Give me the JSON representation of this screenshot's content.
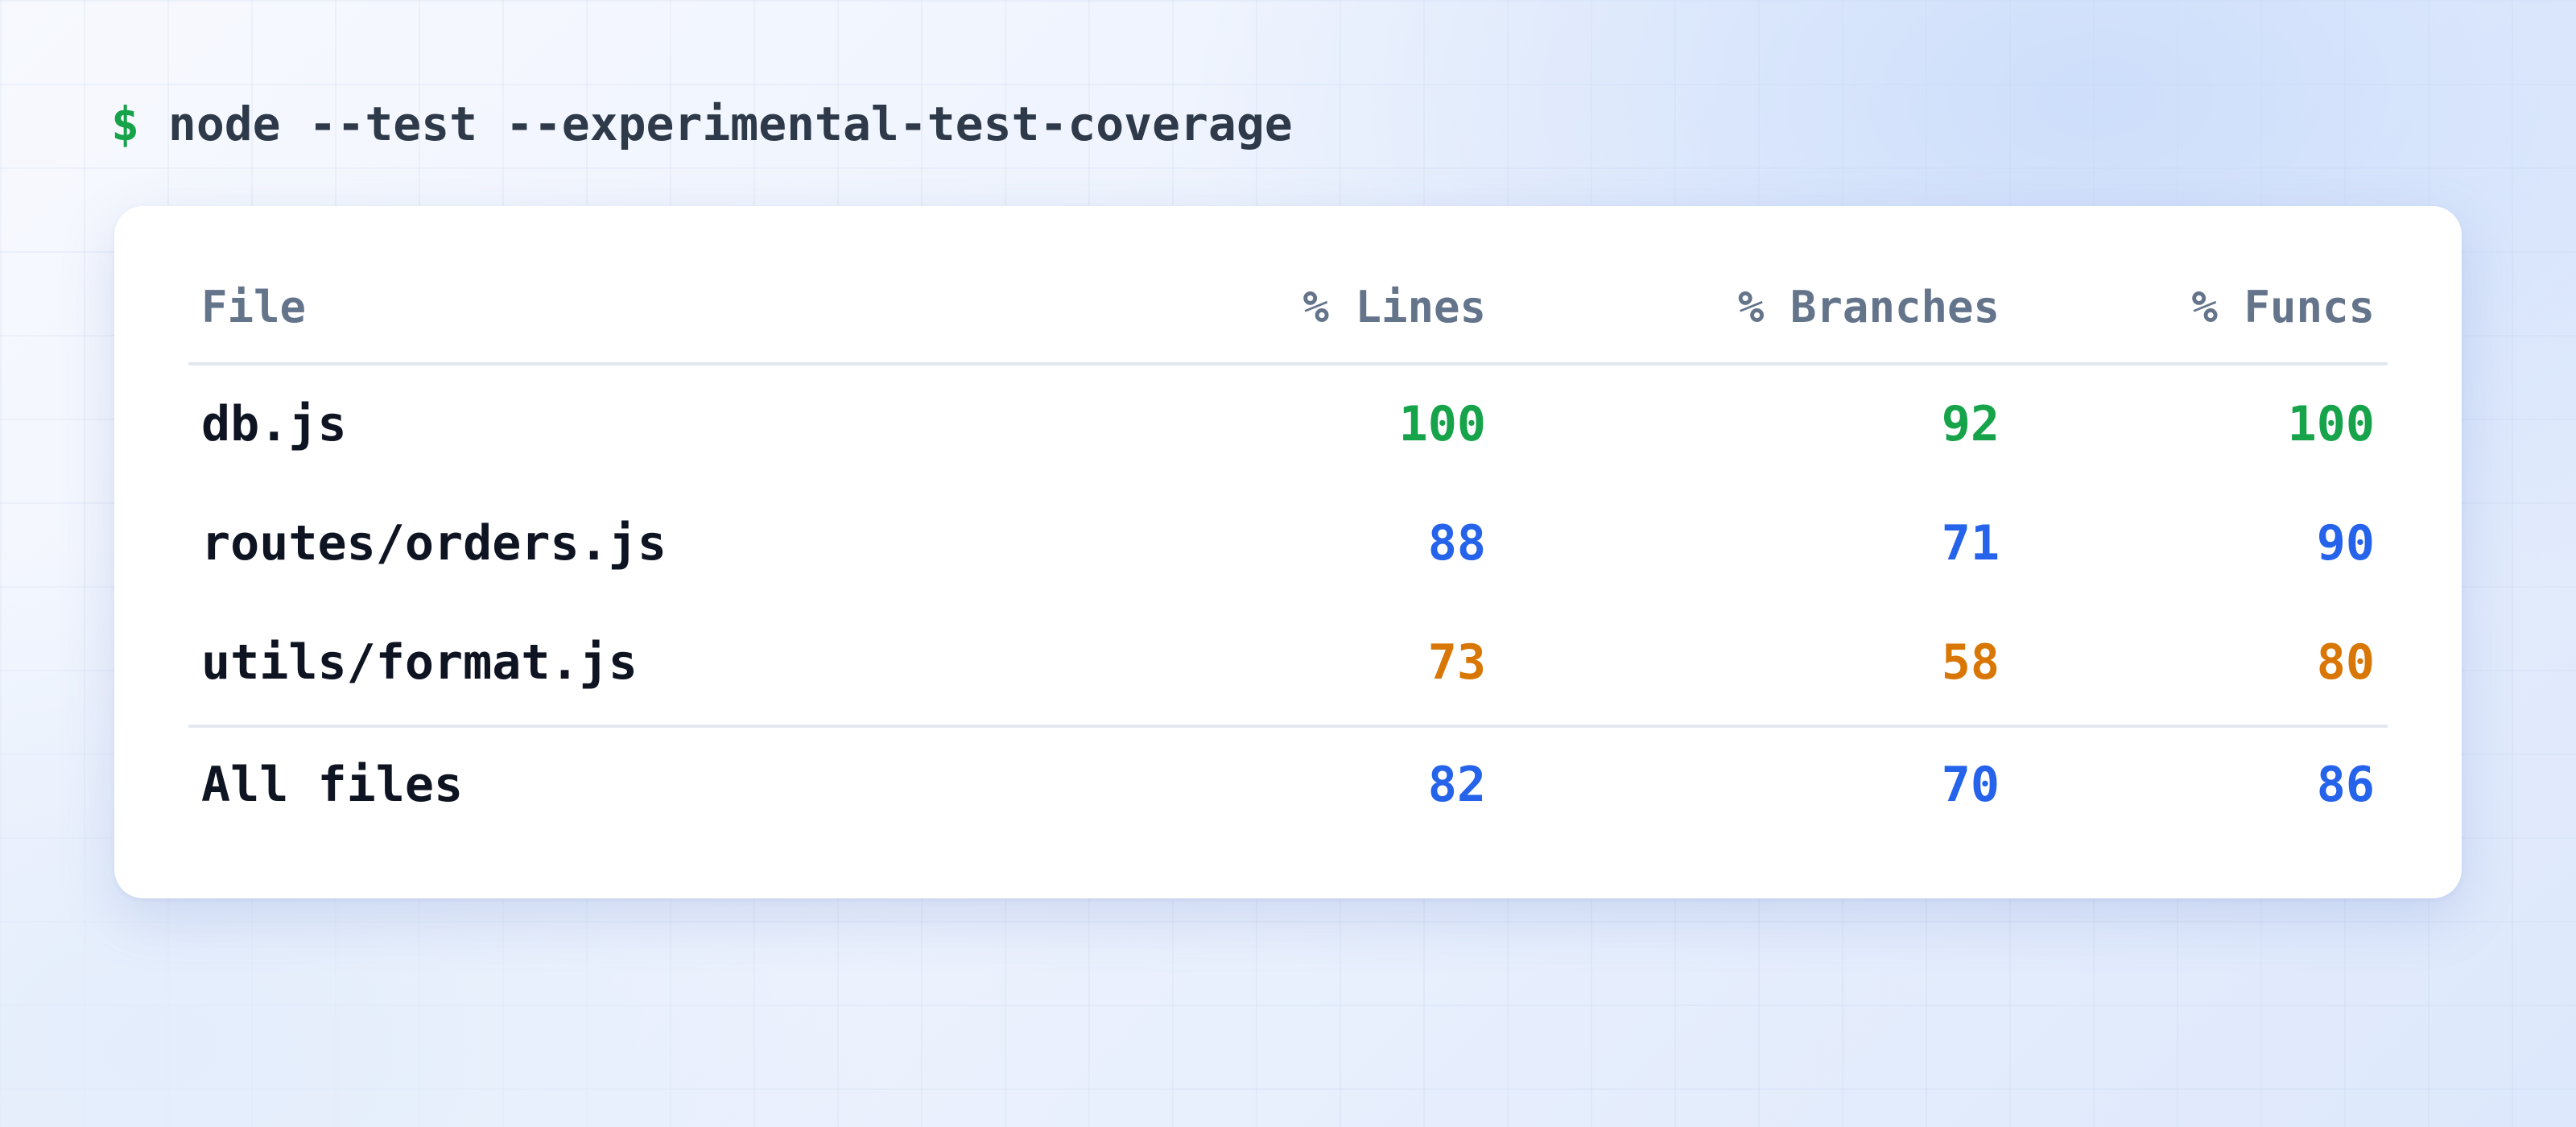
{
  "command": {
    "prompt": "$",
    "text": "node --test --experimental-test-coverage"
  },
  "table": {
    "headers": {
      "file": "File",
      "lines": "% Lines",
      "branches": "% Branches",
      "funcs": "% Funcs"
    },
    "rows": [
      {
        "file": "db.js",
        "lines": "100",
        "branches": "92",
        "funcs": "100"
      },
      {
        "file": "routes/orders.js",
        "lines": "88",
        "branches": "71",
        "funcs": "90"
      },
      {
        "file": "utils/format.js",
        "lines": "73",
        "branches": "58",
        "funcs": "80"
      }
    ],
    "total": {
      "file": "All files",
      "lines": "82",
      "branches": "70",
      "funcs": "86"
    }
  },
  "colors": {
    "high": "#16a34a",
    "medium": "#2563eb",
    "low": "#d97706",
    "header": "#64748b",
    "text": "#0f1422"
  }
}
